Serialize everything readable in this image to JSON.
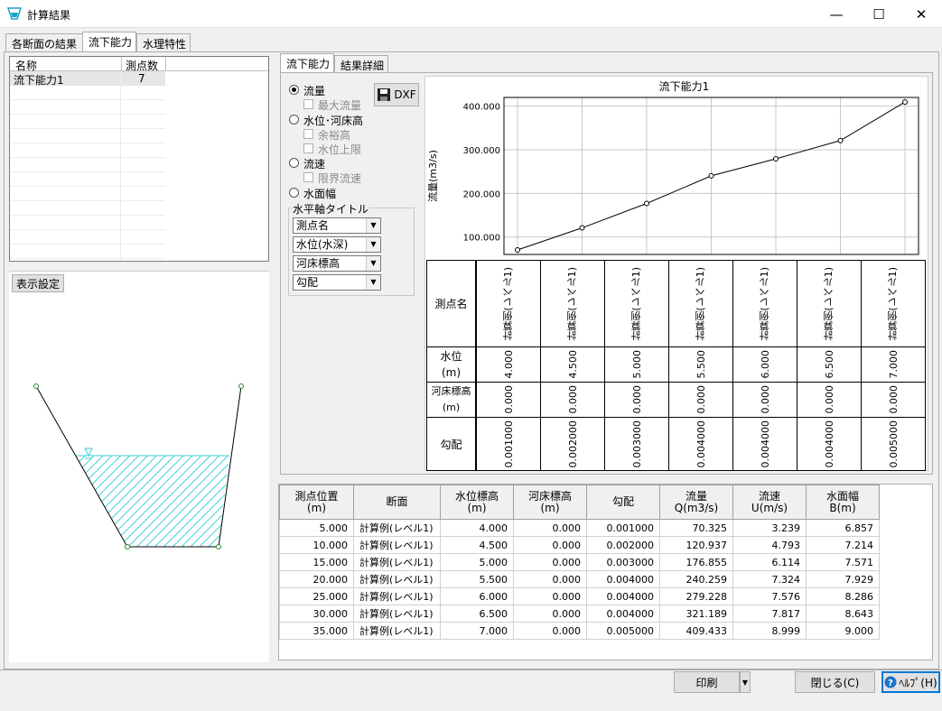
{
  "window": {
    "title": "計算結果",
    "minimize": "—",
    "maximize": "☐",
    "close": "✕"
  },
  "main_tabs": [
    "各断面の結果",
    "流下能力",
    "水理特性"
  ],
  "list": {
    "col_name": "名称",
    "col_count": "測点数",
    "rows": [
      {
        "name": "流下能力1",
        "count": "7"
      }
    ]
  },
  "display_settings_button": "表示設定",
  "sub_tabs": [
    "流下能力",
    "結果詳細"
  ],
  "options": {
    "flow": "流量",
    "max_flow": "最大流量",
    "water_level": "水位･河床高",
    "freeboard": "余裕高",
    "wl_upper": "水位上限",
    "velocity": "流速",
    "critical_velocity": "限界流速",
    "width": "水面幅"
  },
  "dxf_button": "DXF",
  "htitle": {
    "legend": "水平軸タイトル",
    "selects": [
      "測点名",
      "水位(水深)",
      "河床標高",
      "勾配"
    ]
  },
  "chart_data": {
    "type": "line",
    "title": "流下能力1",
    "ylabel": "流量(m3/s)",
    "xlabel": "",
    "y_ticks": [
      "100.000",
      "200.000",
      "300.000",
      "400.000"
    ],
    "ylim": [
      60,
      420
    ],
    "x": [
      1,
      2,
      3,
      4,
      5,
      6,
      7
    ],
    "values": [
      70.325,
      120.937,
      176.855,
      240.259,
      279.228,
      321.189,
      409.433
    ],
    "grid": true
  },
  "chart_table": {
    "row_labels": {
      "station": "測点名",
      "wl": "水位",
      "wl_unit": "(m)",
      "bed": "河床標高",
      "bed_unit": "(m)",
      "slope": "勾配"
    },
    "stations": [
      "計算例(レベル1)",
      "計算例(レベル1)",
      "計算例(レベル1)",
      "計算例(レベル1)",
      "計算例(レベル1)",
      "計算例(レベル1)",
      "計算例(レベル1)"
    ],
    "wl": [
      "4.000",
      "4.500",
      "5.000",
      "5.500",
      "6.000",
      "6.500",
      "7.000"
    ],
    "bed": [
      "0.000",
      "0.000",
      "0.000",
      "0.000",
      "0.000",
      "0.000",
      "0.000"
    ],
    "slope": [
      "0.001000",
      "0.002000",
      "0.003000",
      "0.004000",
      "0.004000",
      "0.004000",
      "0.005000"
    ]
  },
  "results": {
    "headers": [
      [
        "測点位置",
        "(m)"
      ],
      [
        "断面",
        ""
      ],
      [
        "水位標高",
        "(m)"
      ],
      [
        "河床標高",
        "(m)"
      ],
      [
        "勾配",
        ""
      ],
      [
        "流量",
        "Q(m3/s)"
      ],
      [
        "流速",
        "U(m/s)"
      ],
      [
        "水面幅",
        "B(m)"
      ]
    ],
    "rows": [
      [
        "5.000",
        "計算例(レベル1)",
        "4.000",
        "0.000",
        "0.001000",
        "70.325",
        "3.239",
        "6.857"
      ],
      [
        "10.000",
        "計算例(レベル1)",
        "4.500",
        "0.000",
        "0.002000",
        "120.937",
        "4.793",
        "7.214"
      ],
      [
        "15.000",
        "計算例(レベル1)",
        "5.000",
        "0.000",
        "0.003000",
        "176.855",
        "6.114",
        "7.571"
      ],
      [
        "20.000",
        "計算例(レベル1)",
        "5.500",
        "0.000",
        "0.004000",
        "240.259",
        "7.324",
        "7.929"
      ],
      [
        "25.000",
        "計算例(レベル1)",
        "6.000",
        "0.000",
        "0.004000",
        "279.228",
        "7.576",
        "8.286"
      ],
      [
        "30.000",
        "計算例(レベル1)",
        "6.500",
        "0.000",
        "0.004000",
        "321.189",
        "7.817",
        "8.643"
      ],
      [
        "35.000",
        "計算例(レベル1)",
        "7.000",
        "0.000",
        "0.005000",
        "409.433",
        "8.999",
        "9.000"
      ]
    ]
  },
  "footer": {
    "print": "印刷",
    "close": "閉じる(C)",
    "help": "ﾍﾙﾌﾟ(H)"
  }
}
